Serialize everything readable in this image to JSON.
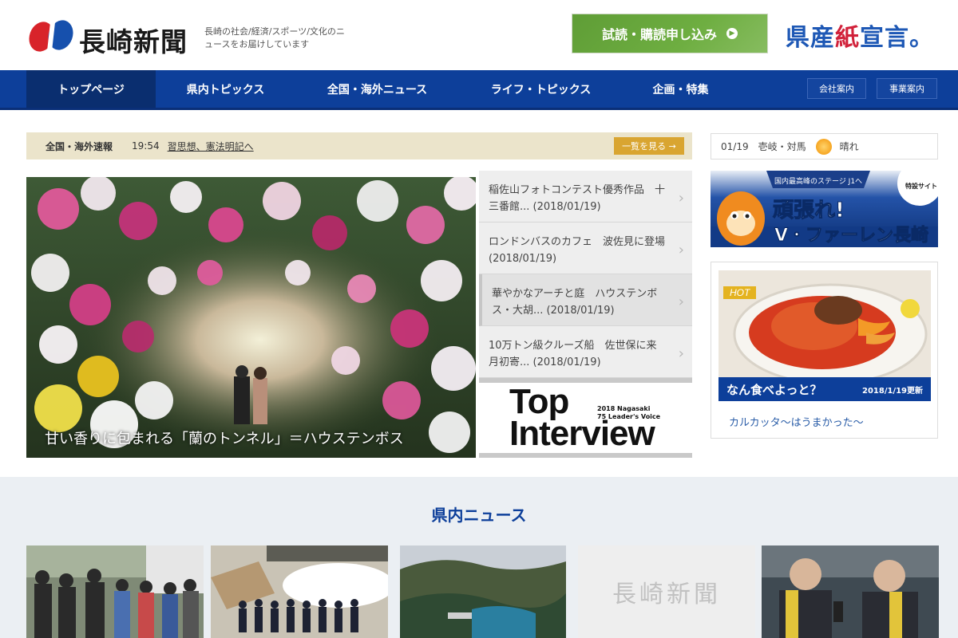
{
  "header": {
    "logo_text": "長崎新聞",
    "tagline": "長崎の社会/経済/スポーツ/文化のニュースをお届けしています",
    "subscribe_label": "試読・購読申し込み",
    "kensan_part1": "県産",
    "kensan_part2": "紙",
    "kensan_part3": "宣言。"
  },
  "nav": {
    "items": [
      {
        "label": "トップページ"
      },
      {
        "label": "県内トピックス"
      },
      {
        "label": "全国・海外ニュース"
      },
      {
        "label": "ライフ・トピックス"
      },
      {
        "label": "企画・特集"
      }
    ],
    "company": "会社案内",
    "business": "事業案内"
  },
  "breaking": {
    "label": "全国・海外速報",
    "time": "19:54",
    "headline": "習思想、憲法明記へ",
    "more": "一覧を見る →"
  },
  "main_story": {
    "caption": "甘い香りに包まれる「蘭のトンネル」＝ハウステンボス"
  },
  "side_list": [
    {
      "title": "稲佐山フォトコンテスト優秀作品　十三番館... (2018/01/19)"
    },
    {
      "title": "ロンドンバスのカフェ　波佐見に登場 (2018/01/19)"
    },
    {
      "title": "華やかなアーチと庭　ハウステンボス・大胡... (2018/01/19)"
    },
    {
      "title": "10万トン級クルーズ船　佐世保に来月初寄... (2018/01/19)"
    }
  ],
  "top_interview": {
    "line1": "Top",
    "line2": "Interview",
    "sub1": "2018 Nagasaki",
    "sub2": "75 Leader's Voice"
  },
  "weather": {
    "date": "01/19",
    "area": "壱岐・対馬",
    "condition": "晴れ",
    "icon": "sun-icon"
  },
  "vvaren": {
    "headline": "頑張れ! V・ファーレン長崎",
    "tag": "特設サイト!",
    "banner_top": "国内最高峰のステージ J1へ"
  },
  "hot": {
    "badge": "HOT",
    "title": "なん食べよっと？",
    "date": "2018/1/19更新",
    "link": "カルカッタ〜はうまかった〜"
  },
  "bottom": {
    "section_title": "県内ニュース",
    "logo_text": "長崎新聞"
  },
  "colors": {
    "nav": "#0d3f9a",
    "breaking_bg": "#ebe4cb",
    "more_btn": "#d9a531",
    "subscribe": "#69a83c"
  }
}
